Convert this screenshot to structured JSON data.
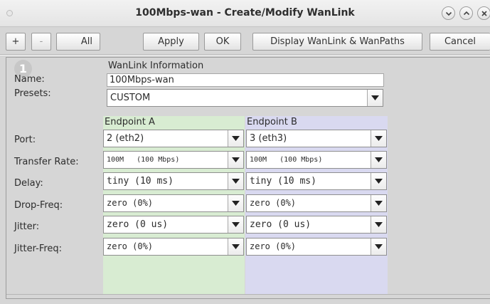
{
  "window": {
    "title": "100Mbps-wan - Create/Modify WanLink",
    "controls": [
      "minimize",
      "maximize",
      "close"
    ]
  },
  "toolbar": {
    "plus_label": "+",
    "minus_label": "-",
    "all_label": "All",
    "apply_mnemonic": "A",
    "apply_rest": "pply",
    "ok_mnemonic": "O",
    "ok_rest": "K",
    "display_label": "Display WanLink & WanPaths",
    "cancel_mnemonic": "C",
    "cancel_rest": "ancel"
  },
  "badge": "1",
  "form": {
    "section_title": "WanLink Information",
    "name_label": "Name:",
    "name_value": "100Mbps-wan",
    "presets_label": "Presets:",
    "presets_value": "CUSTOM",
    "endpoint_a_label": "Endpoint A",
    "endpoint_b_label": "Endpoint B",
    "rows": [
      {
        "label": "Port:",
        "a": "2 (eth2)",
        "b": "3 (eth3)"
      },
      {
        "label": "Transfer Rate:",
        "a": "100M   (100 Mbps)",
        "b": "100M   (100 Mbps)"
      },
      {
        "label": "Delay:",
        "a": "tiny (10 ms)",
        "b": "tiny (10 ms)"
      },
      {
        "label": "Drop-Freq:",
        "a": "zero (0%)",
        "b": "zero (0%)"
      },
      {
        "label": "Jitter:",
        "a": "zero (0 us)",
        "b": "zero (0 us)"
      },
      {
        "label": "Jitter-Freq:",
        "a": "zero (0%)",
        "b": "zero (0%)"
      }
    ]
  },
  "colors": {
    "endpoint_a_bg": "#d8ecd2",
    "endpoint_b_bg": "#d9d9f0"
  }
}
